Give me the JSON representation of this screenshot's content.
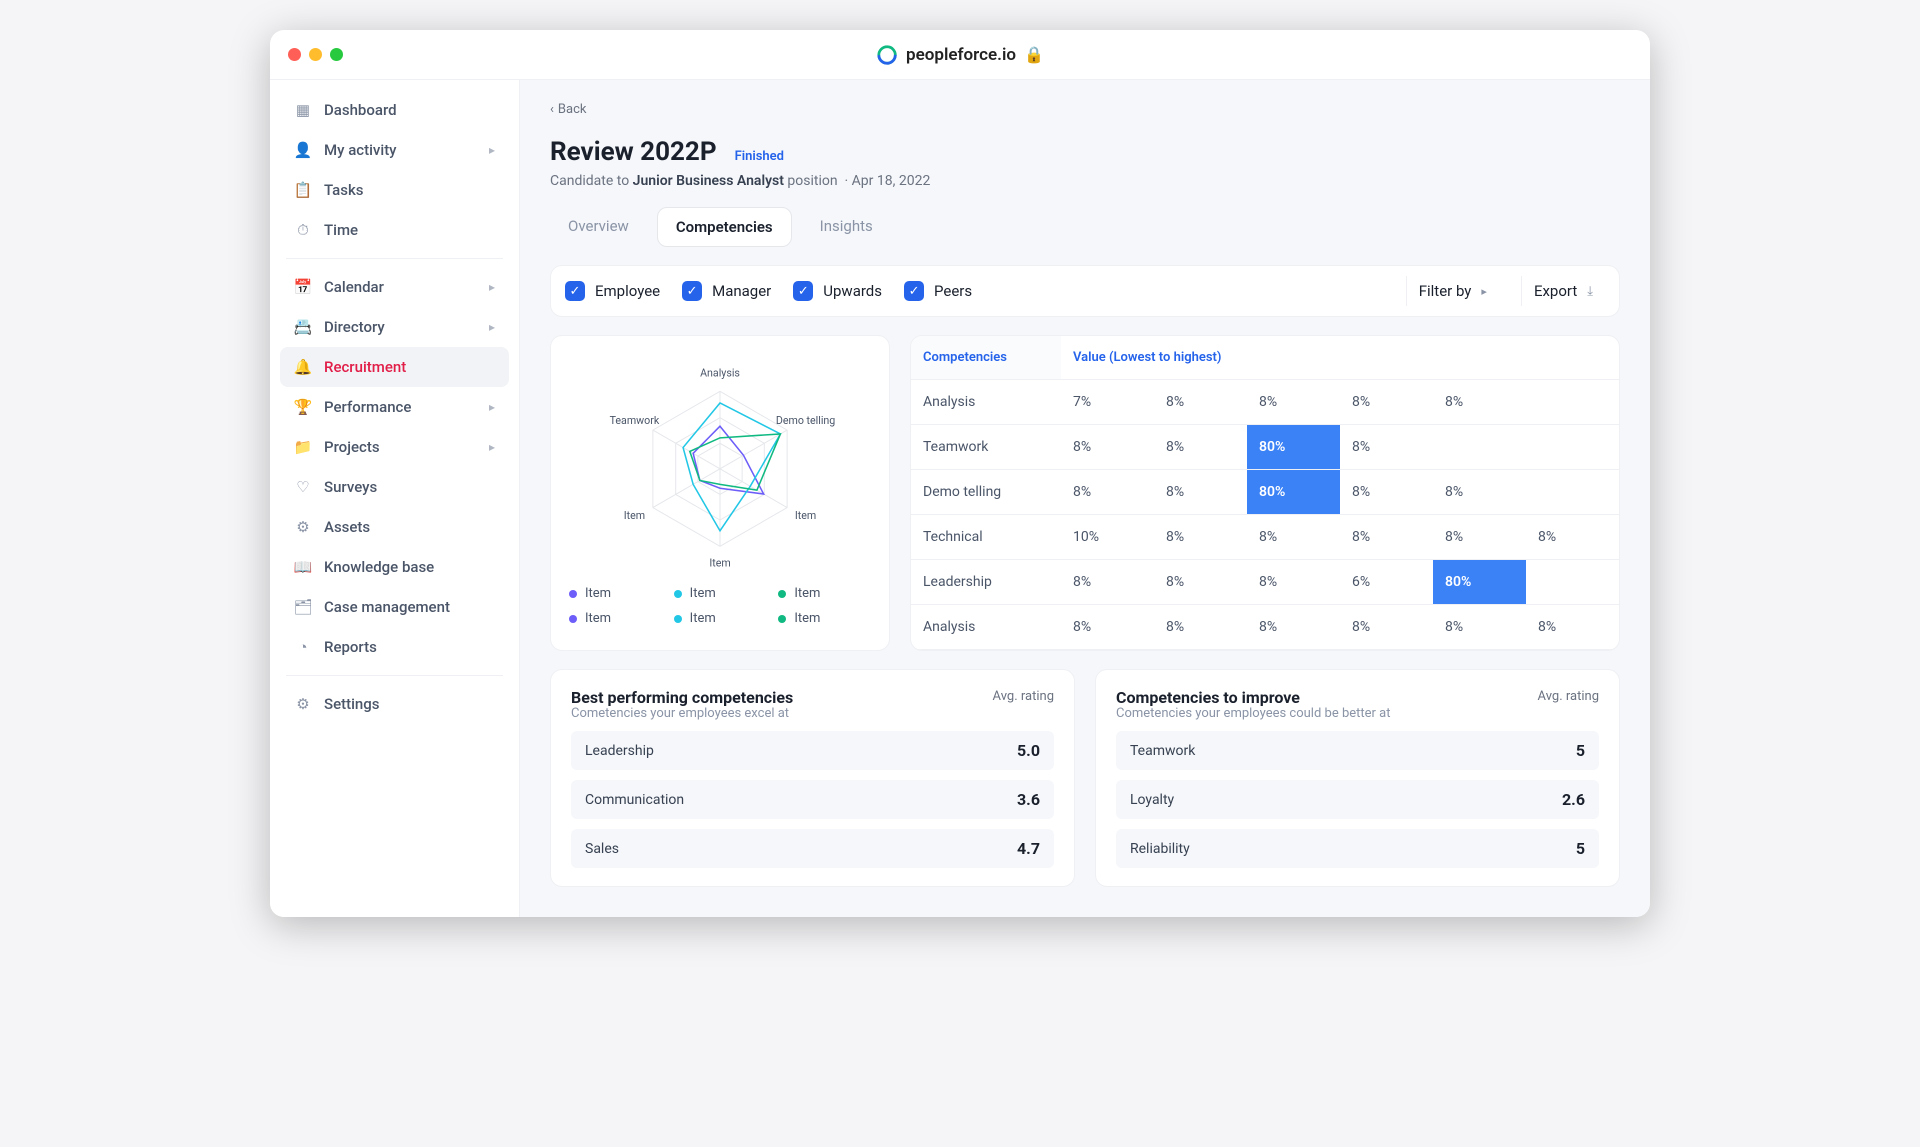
{
  "browser": {
    "site_name": "peopleforce.io"
  },
  "sidebar": {
    "items": [
      {
        "label": "Dashboard",
        "icon": "grid"
      },
      {
        "label": "My activity",
        "icon": "user",
        "chevron": true
      },
      {
        "label": "Tasks",
        "icon": "clipboard"
      },
      {
        "label": "Time",
        "icon": "stopwatch"
      },
      {
        "label": "Calendar",
        "icon": "calendar",
        "chevron": true
      },
      {
        "label": "Directory",
        "icon": "directory",
        "chevron": true
      },
      {
        "label": "Recruitment",
        "icon": "bell",
        "active": true
      },
      {
        "label": "Performance",
        "icon": "trophy",
        "chevron": true
      },
      {
        "label": "Projects",
        "icon": "folder",
        "chevron": true
      },
      {
        "label": "Surveys",
        "icon": "heart"
      },
      {
        "label": "Assets",
        "icon": "assets"
      },
      {
        "label": "Knowledge base",
        "icon": "book"
      },
      {
        "label": "Case management",
        "icon": "case"
      },
      {
        "label": "Reports",
        "icon": "pie"
      },
      {
        "label": "Settings",
        "icon": "gear"
      }
    ]
  },
  "page": {
    "back_label": "Back",
    "title": "Review 2022P",
    "status": "Finished",
    "subtitle_prefix": "Candidate to ",
    "position_name": "Junior Business Analyst",
    "subtitle_suffix": " position",
    "date": "Apr 18, 2022",
    "tabs": [
      {
        "label": "Overview"
      },
      {
        "label": "Competencies",
        "active": true
      },
      {
        "label": "Insights"
      }
    ],
    "filters": {
      "checks": [
        "Employee",
        "Manager",
        "Upwards",
        "Peers"
      ],
      "filter_label": "Filter by",
      "export_label": "Export"
    }
  },
  "chart_data": {
    "type": "radar",
    "axes": [
      "Analysis",
      "Demo telling",
      "Item",
      "Item",
      "Item",
      "Teamwork"
    ],
    "range": [
      0,
      100
    ],
    "series": [
      {
        "name": "Item",
        "color": "#6d5ef9",
        "values": [
          55,
          35,
          65,
          25,
          30,
          40
        ]
      },
      {
        "name": "Item",
        "color": "#22c7e6",
        "values": [
          85,
          90,
          45,
          80,
          40,
          55
        ]
      },
      {
        "name": "Item",
        "color": "#10b981",
        "values": [
          40,
          90,
          55,
          20,
          30,
          45
        ]
      },
      {
        "name": "Item",
        "color": "#6d5ef9",
        "values": [
          50,
          40,
          60,
          30,
          35,
          45
        ]
      },
      {
        "name": "Item",
        "color": "#22c7e6",
        "values": [
          70,
          75,
          50,
          65,
          45,
          50
        ]
      },
      {
        "name": "Item",
        "color": "#10b981",
        "values": [
          45,
          80,
          50,
          25,
          35,
          40
        ]
      }
    ],
    "legend": [
      {
        "label": "Item",
        "color": "#6d5ef9"
      },
      {
        "label": "Item",
        "color": "#22c7e6"
      },
      {
        "label": "Item",
        "color": "#10b981"
      },
      {
        "label": "Item",
        "color": "#6d5ef9"
      },
      {
        "label": "Item",
        "color": "#22c7e6"
      },
      {
        "label": "Item",
        "color": "#10b981"
      }
    ]
  },
  "comp_table": {
    "col1_header": "Competencies",
    "col2_header": "Value (Lowest to highest)",
    "rows": [
      {
        "name": "Analysis",
        "values": [
          "7%",
          "8%",
          "8%",
          "8%",
          "8%",
          ""
        ]
      },
      {
        "name": "Teamwork",
        "values": [
          "8%",
          "8%",
          "80%",
          "8%",
          "",
          ""
        ],
        "highlight": [
          2
        ]
      },
      {
        "name": "Demo telling",
        "values": [
          "8%",
          "8%",
          "80%",
          "8%",
          "8%",
          ""
        ],
        "highlight": [
          2
        ]
      },
      {
        "name": "Technical",
        "values": [
          "10%",
          "8%",
          "8%",
          "8%",
          "8%",
          "8%"
        ]
      },
      {
        "name": "Leadership",
        "values": [
          "8%",
          "8%",
          "8%",
          "6%",
          "80%",
          ""
        ],
        "highlight": [
          4
        ]
      },
      {
        "name": "Analysis",
        "values": [
          "8%",
          "8%",
          "8%",
          "8%",
          "8%",
          "8%"
        ]
      }
    ]
  },
  "best_panel": {
    "title": "Best performing competencies",
    "subtitle": "Cometencies your employees excel at",
    "col_label": "Avg. rating",
    "items": [
      {
        "label": "Leadership",
        "value": "5.0"
      },
      {
        "label": "Communication",
        "value": "3.6"
      },
      {
        "label": "Sales",
        "value": "4.7"
      }
    ]
  },
  "improve_panel": {
    "title": "Competencies to improve",
    "subtitle": "Cometencies your employees could be better at",
    "col_label": "Avg. rating",
    "items": [
      {
        "label": "Teamwork",
        "value": "5"
      },
      {
        "label": "Loyalty",
        "value": "2.6"
      },
      {
        "label": "Reliability",
        "value": "5"
      }
    ]
  }
}
